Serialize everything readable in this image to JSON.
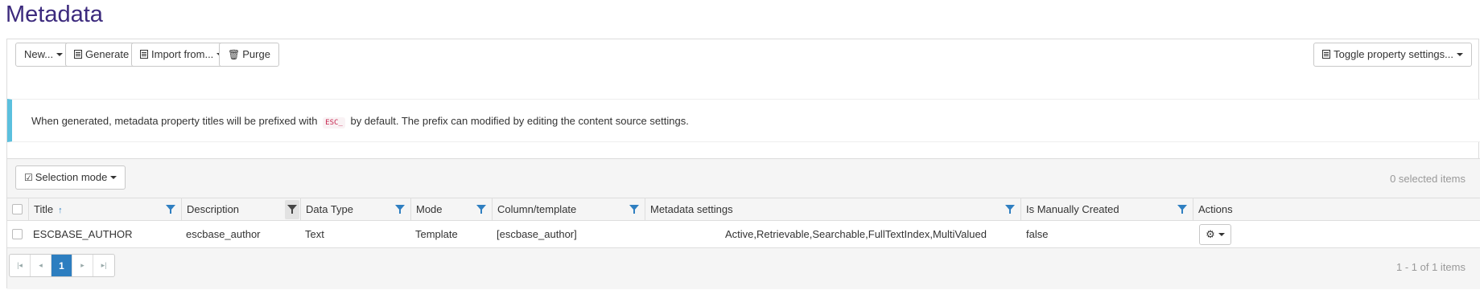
{
  "page": {
    "title": "Metadata"
  },
  "toolbar": {
    "new_label": "New...",
    "generate_label": "Generate",
    "import_label": "Import from...",
    "purge_label": "Purge",
    "toggle_label": "Toggle property settings..."
  },
  "alert": {
    "text_before": "When generated, metadata property titles will be prefixed with",
    "code": "ESC_",
    "text_after": "by default. The prefix can modified by editing the content source settings."
  },
  "grid": {
    "selection_mode_label": "Selection mode",
    "selected_count": "0 selected items",
    "columns": {
      "title": "Title",
      "description": "Description",
      "data_type": "Data Type",
      "mode": "Mode",
      "column_template": "Column/template",
      "metadata_settings": "Metadata settings",
      "is_manually_created": "Is Manually Created",
      "actions": "Actions"
    },
    "rows": [
      {
        "title": "ESCBASE_AUTHOR",
        "description": "escbase_author",
        "data_type": "Text",
        "mode": "Template",
        "column_template": "[escbase_author]",
        "metadata_settings": "Active,Retrievable,Searchable,FullTextIndex,MultiValued",
        "is_manually_created": "false"
      }
    ],
    "pager": {
      "current_page": "1",
      "info": "1 - 1 of 1 items"
    }
  },
  "colors": {
    "title": "#3c2a7d",
    "alert_accent": "#5bc0de",
    "filter_icon": "#2f7fc1",
    "page_active": "#2d7ec0",
    "code_text": "#c7254e"
  },
  "icons": {
    "generate": "table-icon",
    "import": "table-icon",
    "purge": "trash-icon",
    "toggle": "table-icon",
    "selection_mode": "check-square-icon",
    "actions": "gear-icon",
    "filter": "filter-icon",
    "sort": "sort-ascending-icon"
  }
}
